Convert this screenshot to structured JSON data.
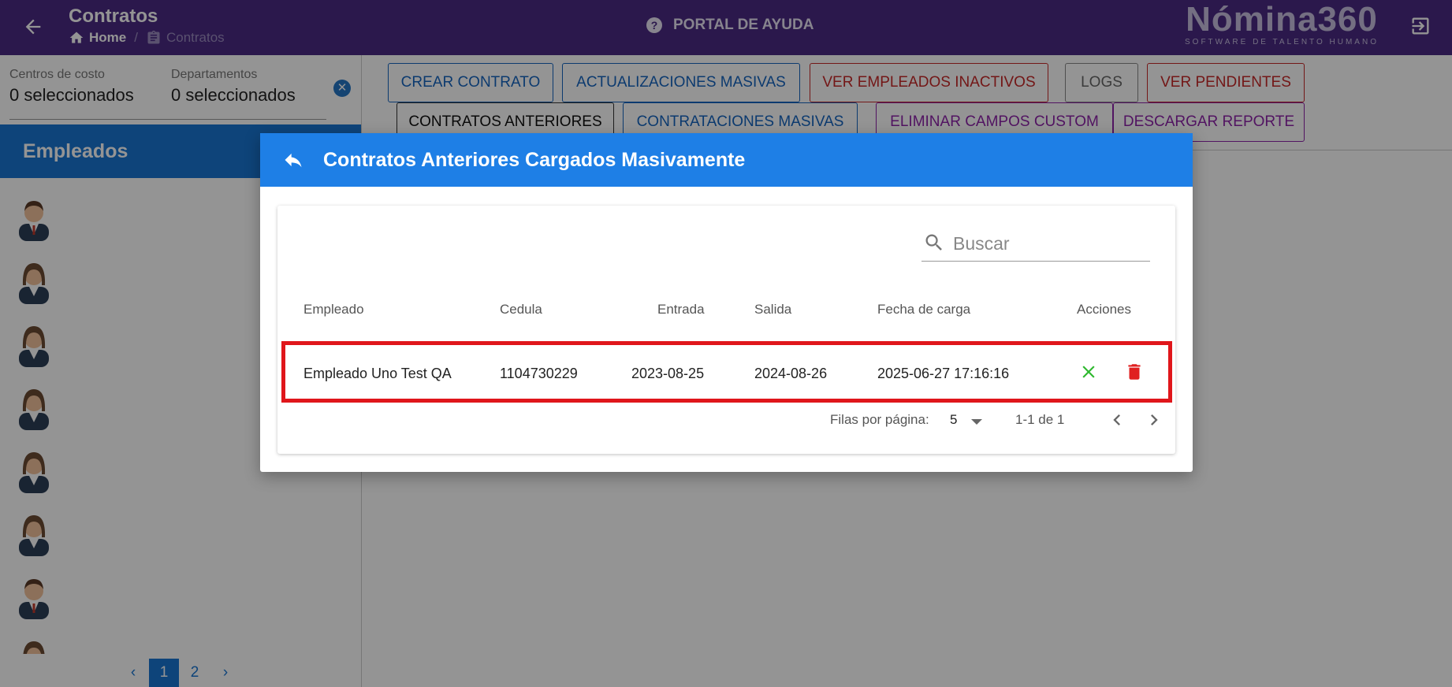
{
  "header": {
    "title": "Contratos",
    "breadcrumb_home": "Home",
    "breadcrumb_separator": "/",
    "breadcrumb_current": "Contratos",
    "help_label": "PORTAL DE AYUDA",
    "logo_text": "Nómina360",
    "logo_tagline": "SOFTWARE DE TALENTO HUMANO"
  },
  "filters": {
    "cost_centers_label": "Centros de costo",
    "cost_centers_value": "0 seleccionados",
    "departments_label": "Departamentos",
    "departments_value": "0 seleccionados"
  },
  "sidebar": {
    "title": "Empleados",
    "pagination": {
      "prev": "‹",
      "pages": [
        "1",
        "2"
      ],
      "next": "›",
      "active_page": "1"
    }
  },
  "toolbar": {
    "row1": [
      "CREAR CONTRATO",
      "ACTUALIZACIONES MASIVAS",
      "VER EMPLEADOS INACTIVOS",
      "LOGS",
      "VER PENDIENTES"
    ],
    "row2": [
      "CONTRATOS ANTERIORES",
      "CONTRATACIONES MASIVAS",
      "ELIMINAR CAMPOS CUSTOM",
      "DESCARGAR REPORTE"
    ]
  },
  "dialog": {
    "title": "Contratos Anteriores Cargados Masivamente",
    "search_placeholder": "Buscar",
    "columns": [
      "Empleado",
      "Cedula",
      "Entrada",
      "Salida",
      "Fecha de carga",
      "Acciones"
    ],
    "rows": [
      {
        "empleado": "Empleado Uno Test QA",
        "cedula": "1104730229",
        "entrada": "2023-08-25",
        "salida": "2024-08-26",
        "fecha_carga": "2025-06-27 17:16:16"
      }
    ],
    "footer": {
      "rows_per_page_label": "Filas por página:",
      "rows_per_page_value": "5",
      "range": "1-1 de 1"
    }
  },
  "colors": {
    "header_bg": "#4a2a84",
    "primary_blue": "#1976d2",
    "dialog_header": "#1e7fe6",
    "highlight_red": "#e0161b",
    "approve_green": "#2eb82e",
    "delete_red": "#e02020"
  },
  "icons": {
    "back": "arrow-left-icon",
    "home": "home-icon",
    "clipboard": "clipboard-icon",
    "help": "help-circle-icon",
    "logout": "logout-icon",
    "clear": "close-circle-icon",
    "reply": "reply-icon",
    "search": "search-icon",
    "approve": "close-x-icon",
    "delete": "trash-icon"
  }
}
